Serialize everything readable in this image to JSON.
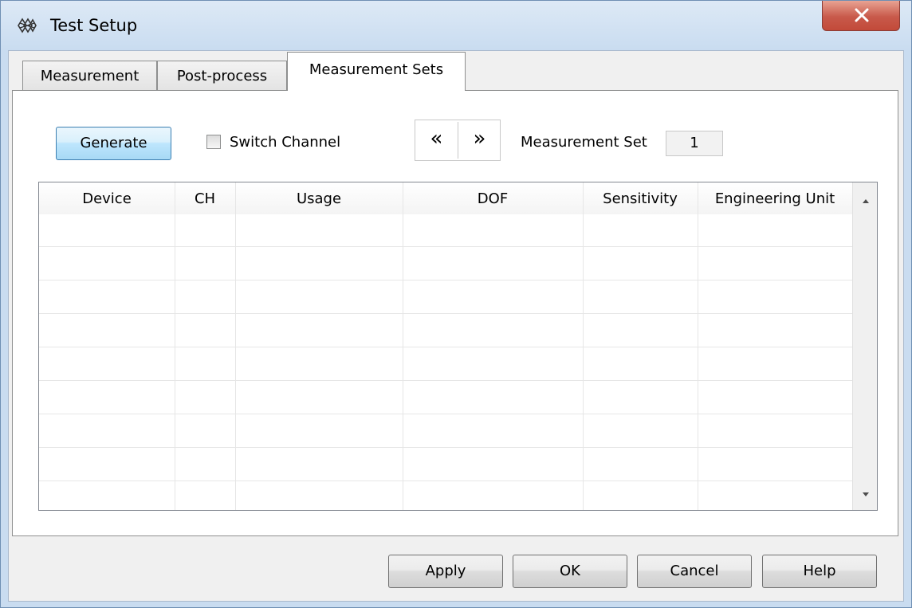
{
  "window": {
    "title": "Test Setup",
    "close_symbol": "X"
  },
  "tabs": [
    {
      "label": "Measurement",
      "active": false
    },
    {
      "label": "Post-process",
      "active": false
    },
    {
      "label": "Measurement Sets",
      "active": true
    }
  ],
  "toolbar": {
    "generate_label": "Generate",
    "switch_channel_label": "Switch Channel",
    "switch_channel_checked": false,
    "prev_label": "«",
    "next_label": "»",
    "measurement_set_label": "Measurement Set",
    "measurement_set_value": "1"
  },
  "grid": {
    "columns": [
      "Device",
      "CH",
      "Usage",
      "DOF",
      "Sensitivity",
      "Engineering Unit"
    ],
    "rows": []
  },
  "footer": {
    "apply_label": "Apply",
    "ok_label": "OK",
    "cancel_label": "Cancel",
    "help_label": "Help"
  },
  "icons": {
    "app": "test-setup-icon",
    "close": "close-icon",
    "scroll_up": "scroll-up-arrow-icon",
    "scroll_down": "scroll-down-arrow-icon"
  },
  "colors": {
    "title_bar": "#c9dcf0",
    "close_button": "#c8594a",
    "default_button": "#bee6fd"
  }
}
